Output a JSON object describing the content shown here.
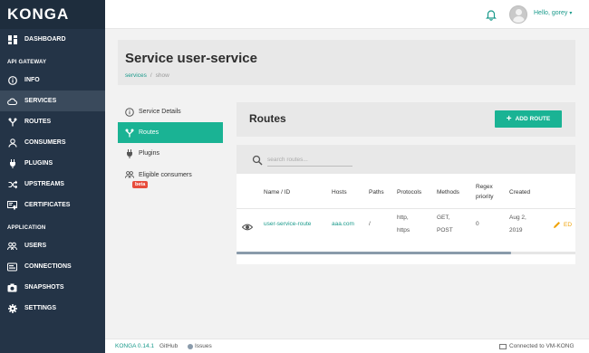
{
  "app": {
    "brand": "KONGA"
  },
  "topbar": {
    "greeting": "Hello, gorey",
    "bell_icon": "bell-icon",
    "accent": "#1a9a8b"
  },
  "sidebar": {
    "dashboard": "DASHBOARD",
    "section_api": "API GATEWAY",
    "info": "INFO",
    "services": "SERVICES",
    "routes": "ROUTES",
    "consumers": "CONSUMERS",
    "plugins": "PLUGINS",
    "upstreams": "UPSTREAMS",
    "certificates": "CERTIFICATES",
    "section_app": "APPLICATION",
    "users": "USERS",
    "connections": "CONNECTIONS",
    "snapshots": "SNAPSHOTS",
    "settings": "SETTINGS",
    "active_item": "SERVICES",
    "bg_color": "#243447"
  },
  "header": {
    "title": "Service user-service",
    "breadcrumb_services": "services",
    "breadcrumb_sep": "/",
    "breadcrumb_current": "show"
  },
  "tabs": {
    "details": "Service Details",
    "routes": "Routes",
    "plugins": "Plugins",
    "eligible": "Eligible consumers",
    "beta_badge": "beta",
    "active_tab": "Routes",
    "active_color": "#1ab394"
  },
  "routes": {
    "title": "Routes",
    "add_button": "ADD ROUTE",
    "search_placeholder": "search routes...",
    "columns": {
      "name": "Name / ID",
      "hosts": "Hosts",
      "paths": "Paths",
      "protocols_line": "Protocols",
      "methods": "Methods",
      "regex_1": "Regex",
      "regex_2": "priority",
      "created": "Created"
    },
    "rows": [
      {
        "name": "user-service-route",
        "hosts": "aaa.com",
        "paths": "/",
        "protocol_1": "http,",
        "protocol_2": "https",
        "method_1": "GET,",
        "method_2": "POST",
        "regex": "0",
        "created_1": "Aug 2,",
        "created_2": "2019",
        "edit": "ED"
      }
    ],
    "scroll_fraction": 0.81
  },
  "footer": {
    "version": "KONGA 0.14.1",
    "github": "GitHub",
    "issues": "Issues",
    "connection": "Connected to VM-KONG"
  }
}
